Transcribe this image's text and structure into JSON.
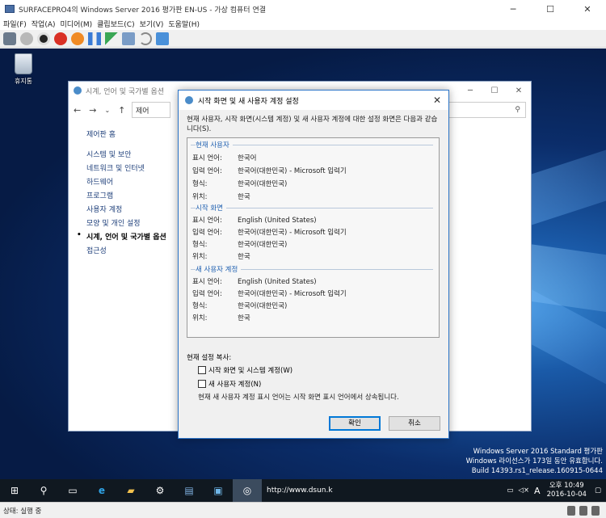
{
  "vm": {
    "title": "SURFACEPRO4의 Windows Server 2016 평가판 EN-US - 가상 컴퓨터 연결",
    "menu": [
      "파일(F)",
      "작업(A)",
      "미디어(M)",
      "클립보드(C)",
      "보기(V)",
      "도움말(H)"
    ]
  },
  "desktop": {
    "recycle_label": "휴지통",
    "watermark": [
      "Windows Server 2016 Standard 평가판",
      "Windows 라이선스가 173일 동안 유효합니다.",
      "Build 14393.rs1_release.160915-0644"
    ]
  },
  "control_panel": {
    "title": "시계, 언어 및 국가별 옵션",
    "address": "제어",
    "sidebar": [
      "제어판 홈",
      "시스템 및 보안",
      "네트워크 및 인터넷",
      "하드웨어",
      "프로그램",
      "사용자 계정",
      "모양 및 개인 설정",
      "시계, 언어 및 국가별 옵션",
      "접근성"
    ]
  },
  "dialog": {
    "title": "시작 화면 및 새 사용자 계정 설정",
    "description": "현재 사용자, 시작 화면(시스템 계정) 및 새 사용자 계정에 대한 설정 화면은 다음과 같습니다(S).",
    "sections": [
      {
        "title": "현재 사용자",
        "rows": [
          {
            "k": "표시 언어:",
            "v": "한국어"
          },
          {
            "k": "입력 언어:",
            "v": "한국어(대한민국) - Microsoft 입력기"
          },
          {
            "k": "형식:",
            "v": "한국어(대한민국)"
          },
          {
            "k": "위치:",
            "v": "한국"
          }
        ]
      },
      {
        "title": "시작 화면",
        "rows": [
          {
            "k": "표시 언어:",
            "v": "English (United States)"
          },
          {
            "k": "입력 언어:",
            "v": "한국어(대한민국) - Microsoft 입력기"
          },
          {
            "k": "형식:",
            "v": "한국어(대한민국)"
          },
          {
            "k": "위치:",
            "v": "한국"
          }
        ]
      },
      {
        "title": "새 사용자 계정",
        "rows": [
          {
            "k": "표시 언어:",
            "v": "English (United States)"
          },
          {
            "k": "입력 언어:",
            "v": "한국어(대한민국) - Microsoft 입력기"
          },
          {
            "k": "형식:",
            "v": "한국어(대한민국)"
          },
          {
            "k": "위치:",
            "v": "한국"
          }
        ]
      }
    ],
    "copy_label": "현재 설정 복사:",
    "checkbox_welcome": "시작 화면 및 시스템 계정(W)",
    "checkbox_newuser": "새 사용자 계정(N)",
    "note": "현재 새 사용자 계정 표시 언어는 시작 화면 표시 언어에서 상속됩니다.",
    "ok": "확인",
    "cancel": "취소"
  },
  "taskbar": {
    "url": "http://www.dsun.k",
    "clock_time": "오후 10:49",
    "clock_date": "2016-10-04",
    "ime": "A"
  },
  "status": "상태: 실행 중",
  "colors": {
    "accent": "#0078d7",
    "link": "#1e3f7a",
    "section": "#2161b1"
  }
}
